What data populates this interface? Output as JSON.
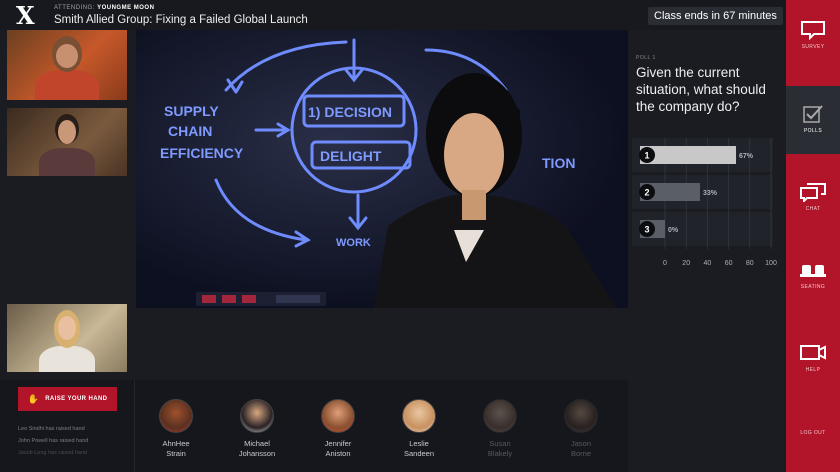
{
  "header": {
    "logo": "X",
    "attending_label": "ATTENDING:",
    "attending_name": "YOUNGME MOON",
    "title": "Smith Allied Group: Fixing a Failed Global Launch",
    "timer": "Class ends in 67 minutes"
  },
  "raise_hand": {
    "label": "RAISE YOUR HAND",
    "notices": [
      "Leo Sindhi has raised hand",
      "John Powell has raised hand",
      "Jacob Long has raised hand"
    ]
  },
  "attendees": [
    {
      "first": "AhnHee",
      "last": "Strain"
    },
    {
      "first": "Michael",
      "last": "Johansson"
    },
    {
      "first": "Jennifer",
      "last": "Aniston"
    },
    {
      "first": "Leslie",
      "last": "Sandeen"
    },
    {
      "first": "Susan",
      "last": "Blakely"
    },
    {
      "first": "Jason",
      "last": "Borne"
    }
  ],
  "poll": {
    "label": "POLL 1",
    "question": "Given the current situation, what should the company do?"
  },
  "chart_data": {
    "type": "bar",
    "orientation": "horizontal",
    "categories": [
      "1",
      "2",
      "3"
    ],
    "values": [
      67,
      33,
      0
    ],
    "value_labels": [
      "67%",
      "33%",
      "0%"
    ],
    "xlim": [
      0,
      100
    ],
    "xticks": [
      "0",
      "20",
      "40",
      "60",
      "80",
      "100"
    ],
    "grid": true
  },
  "nav": [
    {
      "label": "SURVEY",
      "icon": "survey-icon"
    },
    {
      "label": "POLLS",
      "icon": "poll-icon"
    },
    {
      "label": "CHAT",
      "icon": "chat-icon"
    },
    {
      "label": "SEATING",
      "icon": "seating-icon"
    },
    {
      "label": "HELP",
      "icon": "help-icon"
    },
    {
      "label": "LOG OUT",
      "icon": "logout-icon"
    }
  ],
  "whiteboard": {
    "texts": [
      "SUPPLY",
      "CHAIN",
      "EFFICIENCY",
      "1) DECISION",
      "DELIGHT",
      "TION",
      "WORK"
    ]
  },
  "colors": {
    "accent": "#b2152a",
    "bar": "#c8c8c8",
    "whiteboard_ink": "#6f8cff"
  }
}
